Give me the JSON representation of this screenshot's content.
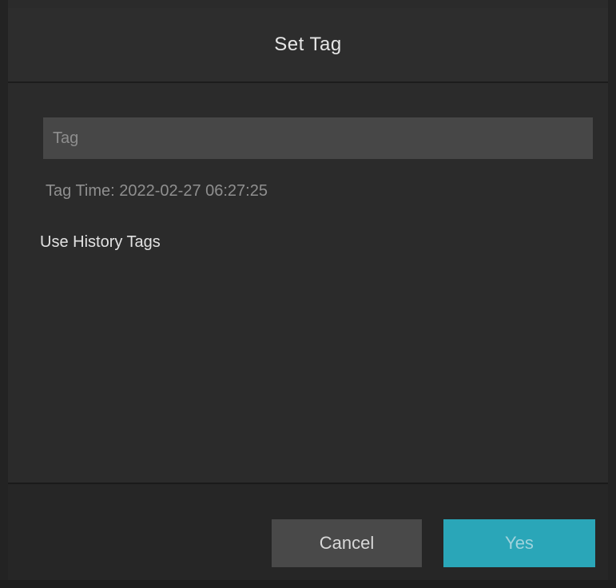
{
  "dialog": {
    "title": "Set Tag",
    "tag_input": {
      "placeholder": "Tag",
      "value": ""
    },
    "tag_time": "Tag Time: 2022-02-27 06:27:25",
    "history_link": "Use History Tags"
  },
  "footer": {
    "cancel_label": "Cancel",
    "ok_label": "Yes"
  },
  "colors": {
    "accent": "#2aa6b8",
    "background": "#2b2b2b",
    "input_bg": "#474747"
  }
}
